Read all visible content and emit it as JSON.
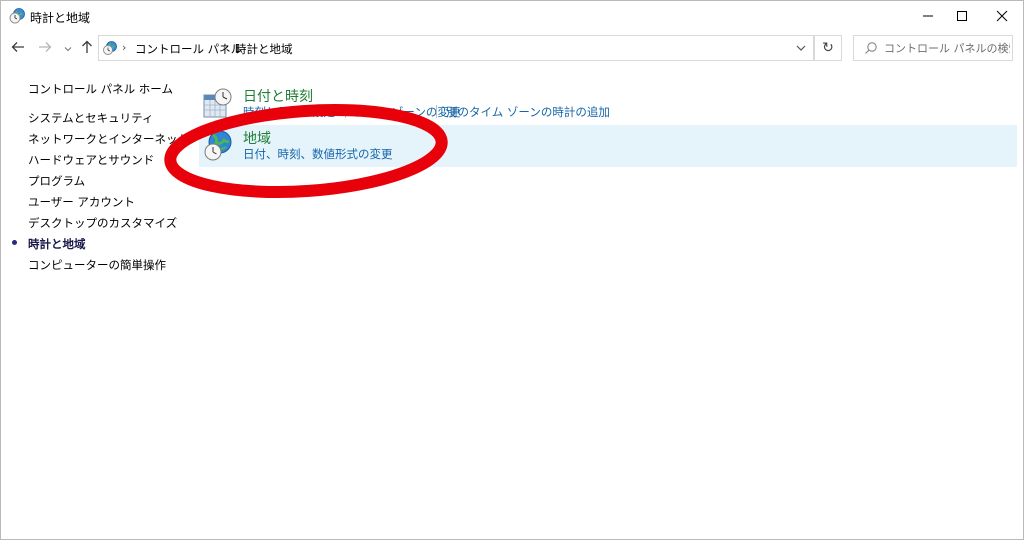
{
  "window": {
    "title": "時計と地域"
  },
  "address": {
    "crumbs": [
      "コントロール パネル",
      "時計と地域"
    ],
    "refresh_icon": "↻"
  },
  "search": {
    "placeholder": "コントロール パネルの検索"
  },
  "sidebar": {
    "home_label": "コントロール パネル ホーム",
    "items": [
      {
        "label": "システムとセキュリティ"
      },
      {
        "label": "ネットワークとインターネット"
      },
      {
        "label": "ハードウェアとサウンド"
      },
      {
        "label": "プログラム"
      },
      {
        "label": "ユーザー アカウント"
      },
      {
        "label": "デスクトップのカスタマイズ"
      },
      {
        "label": "時計と地域",
        "current": true
      },
      {
        "label": "コンピューターの簡単操作"
      }
    ]
  },
  "categories": {
    "datetime": {
      "title": "日付と時刻",
      "links": [
        "時刻と日付の設定",
        "タイム ゾーンの変更",
        "別のタイム ゾーンの時計の追加"
      ]
    },
    "region": {
      "title": "地域",
      "links": [
        "日付、時刻、数値形式の変更"
      ]
    }
  },
  "icons": {
    "title": "clock-globe-icon",
    "back": "arrow-left-icon",
    "forward": "arrow-right-icon",
    "recent": "chevron-down-icon",
    "up": "arrow-up-icon",
    "search": "search-icon",
    "datetime": "calendar-clock-icon",
    "region": "globe-clock-icon"
  },
  "colors": {
    "category_title": "#1e7e34",
    "link": "#1565a8",
    "hover_bg": "#e5f3fb",
    "annotation": "#e8000b"
  }
}
